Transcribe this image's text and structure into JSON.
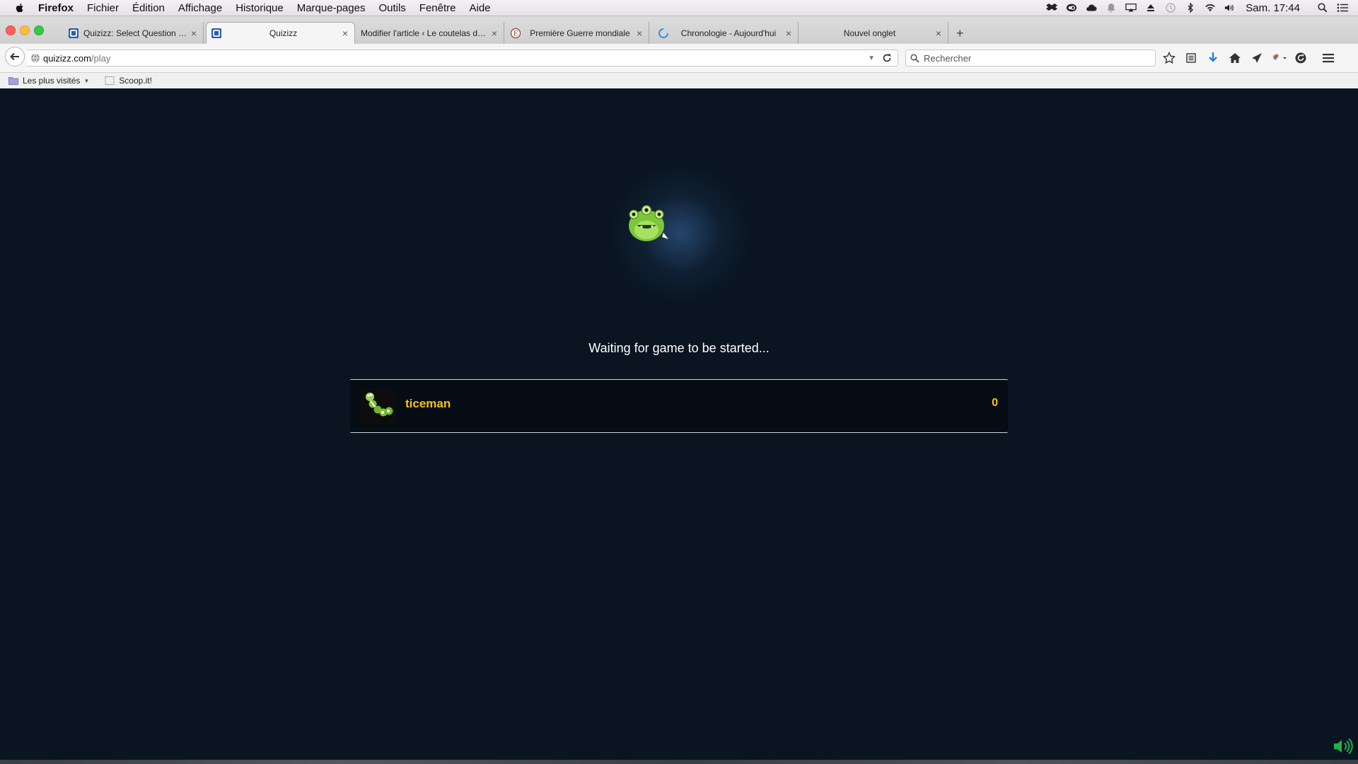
{
  "menubar": {
    "app_name": "Firefox",
    "items": [
      "Fichier",
      "Édition",
      "Affichage",
      "Historique",
      "Marque-pages",
      "Outils",
      "Fenêtre",
      "Aide"
    ],
    "clock": "Sam. 17:44",
    "tray_icons": [
      "dropbox-icon",
      "creative-cloud-icon",
      "cloud-icon",
      "notification-icon",
      "airplay-icon",
      "eject-icon",
      "time-machine-icon",
      "bluetooth-icon",
      "wifi-icon",
      "volume-icon",
      "spotlight-icon",
      "notification-center-icon"
    ]
  },
  "tabs": [
    {
      "label": "Quizizz: Select Question Set",
      "icon": "quizizz-icon",
      "active": false
    },
    {
      "label": "Quizizz",
      "icon": "quizizz-icon",
      "active": true
    },
    {
      "label": "Modifier l'article ‹ Le coutelas de…",
      "icon": "",
      "active": false
    },
    {
      "label": "Première Guerre mondiale",
      "icon": "wiki-icon",
      "active": false
    },
    {
      "label": "Chronologie - Aujourd'hui",
      "icon": "loading-icon",
      "active": false
    },
    {
      "label": "Nouvel onglet",
      "icon": "",
      "active": false
    }
  ],
  "new_tab_label": "+",
  "close_glyph": "×",
  "navbar": {
    "url_host": "quizizz.com",
    "url_path": "/play",
    "search_placeholder": "Rechercher"
  },
  "bookmarks": {
    "most_visited": "Les plus visités",
    "scoopit": "Scoop.it!"
  },
  "page": {
    "status": "Waiting for game to be started...",
    "players": [
      {
        "name": "ticeman",
        "score": "0"
      }
    ],
    "colors": {
      "background": "#0a1521",
      "player_name": "#f6c21a",
      "sound_icon": "#1fb14a"
    }
  }
}
